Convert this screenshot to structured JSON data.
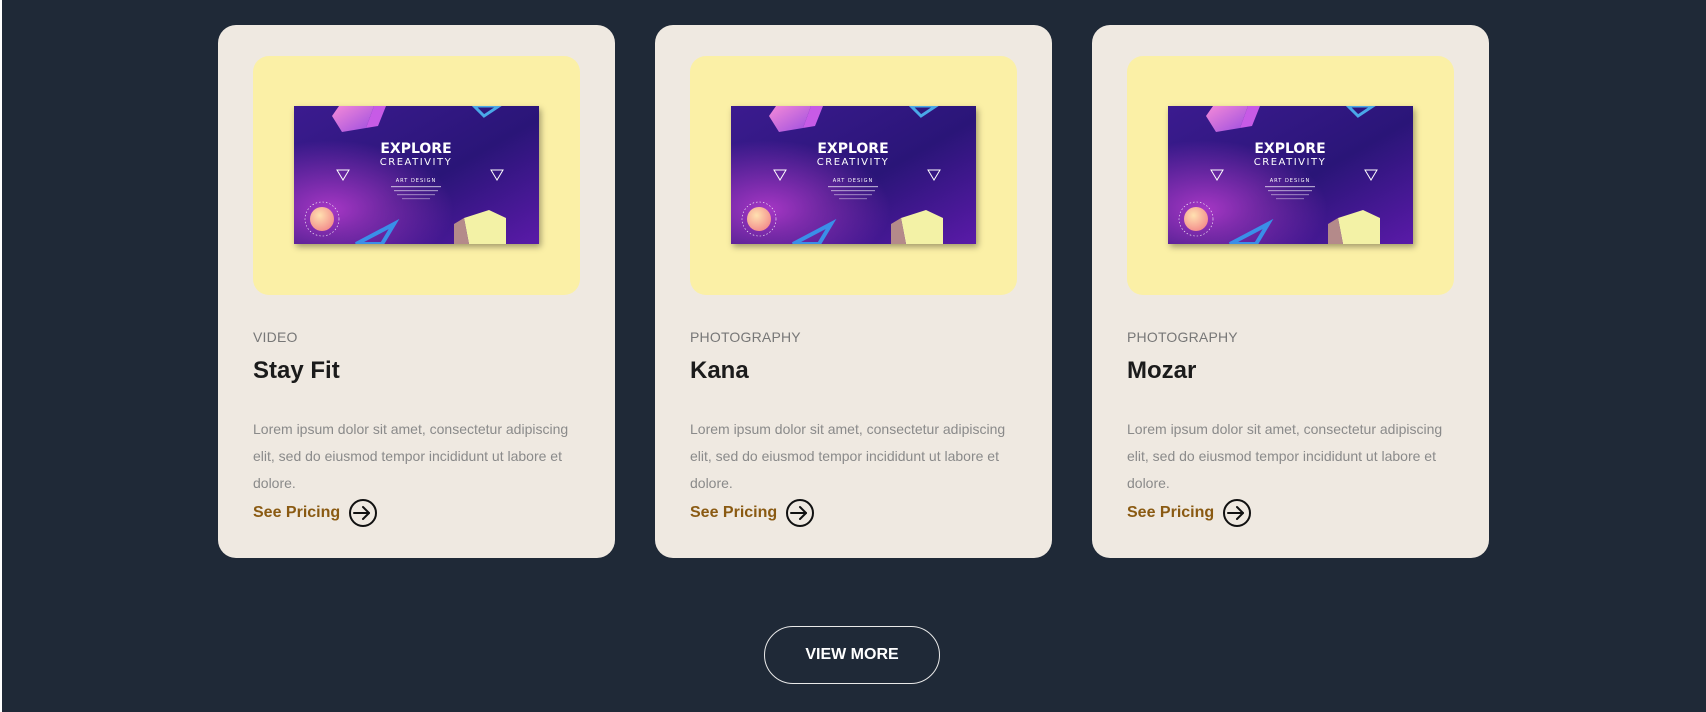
{
  "cards": [
    {
      "category": "VIDEO",
      "title": "Stay Fit",
      "description": "Lorem ipsum dolor sit amet, consectetur adipiscing elit, sed do eiusmod tempor incididunt ut labore et dolore.",
      "link_label": "See Pricing",
      "thumbnail": {
        "headline": "EXPLORE",
        "subheadline": "CREATIVITY",
        "caption": "ART DESIGN"
      }
    },
    {
      "category": "PHOTOGRAPHY",
      "title": "Kana",
      "description": "Lorem ipsum dolor sit amet, consectetur adipiscing elit, sed do eiusmod tempor incididunt ut labore et dolore.",
      "link_label": "See Pricing",
      "thumbnail": {
        "headline": "EXPLORE",
        "subheadline": "CREATIVITY",
        "caption": "ART DESIGN"
      }
    },
    {
      "category": "PHOTOGRAPHY",
      "title": "Mozar",
      "description": "Lorem ipsum dolor sit amet, consectetur adipiscing elit, sed do eiusmod tempor incididunt ut labore et dolore.",
      "link_label": "See Pricing",
      "thumbnail": {
        "headline": "EXPLORE",
        "subheadline": "CREATIVITY",
        "caption": "ART DESIGN"
      }
    }
  ],
  "view_more_label": "VIEW MORE",
  "icons": {
    "link_icon": "arrow-right-circle-icon"
  },
  "colors": {
    "page_background": "#1f2937",
    "card_background": "#efe9e1",
    "thumbnail_background": "#fbf0a6",
    "link_color": "#8a5a12"
  }
}
